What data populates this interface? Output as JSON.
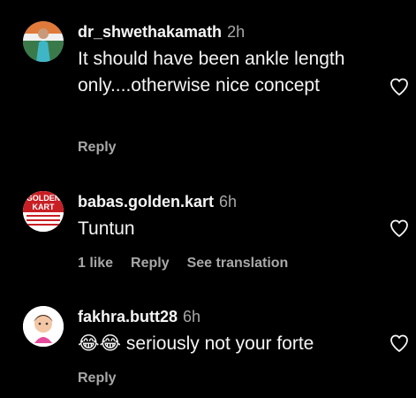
{
  "comments": [
    {
      "username": "dr_shwethakamath",
      "time": "2h",
      "text": "It should have been ankle length only....otherwise nice concept",
      "likes": "",
      "reply": "Reply",
      "see_translation": ""
    },
    {
      "username": "babas.golden.kart",
      "time": "6h",
      "text": "Tuntun",
      "likes": "1 like",
      "reply": "Reply",
      "see_translation": "See translation",
      "avatar_text_1": "GOLDEN",
      "avatar_text_2": "KART"
    },
    {
      "username": "fakhra.butt28",
      "time": "6h",
      "emoji": "😂😂",
      "text": "seriously not your forte",
      "likes": "",
      "reply": "Reply",
      "see_translation": ""
    }
  ],
  "colors": {
    "background": "#000000",
    "primary_text": "#f5f5f5",
    "secondary_text": "#a8a8a8"
  },
  "icons": [
    "avatar",
    "heart-icon"
  ]
}
